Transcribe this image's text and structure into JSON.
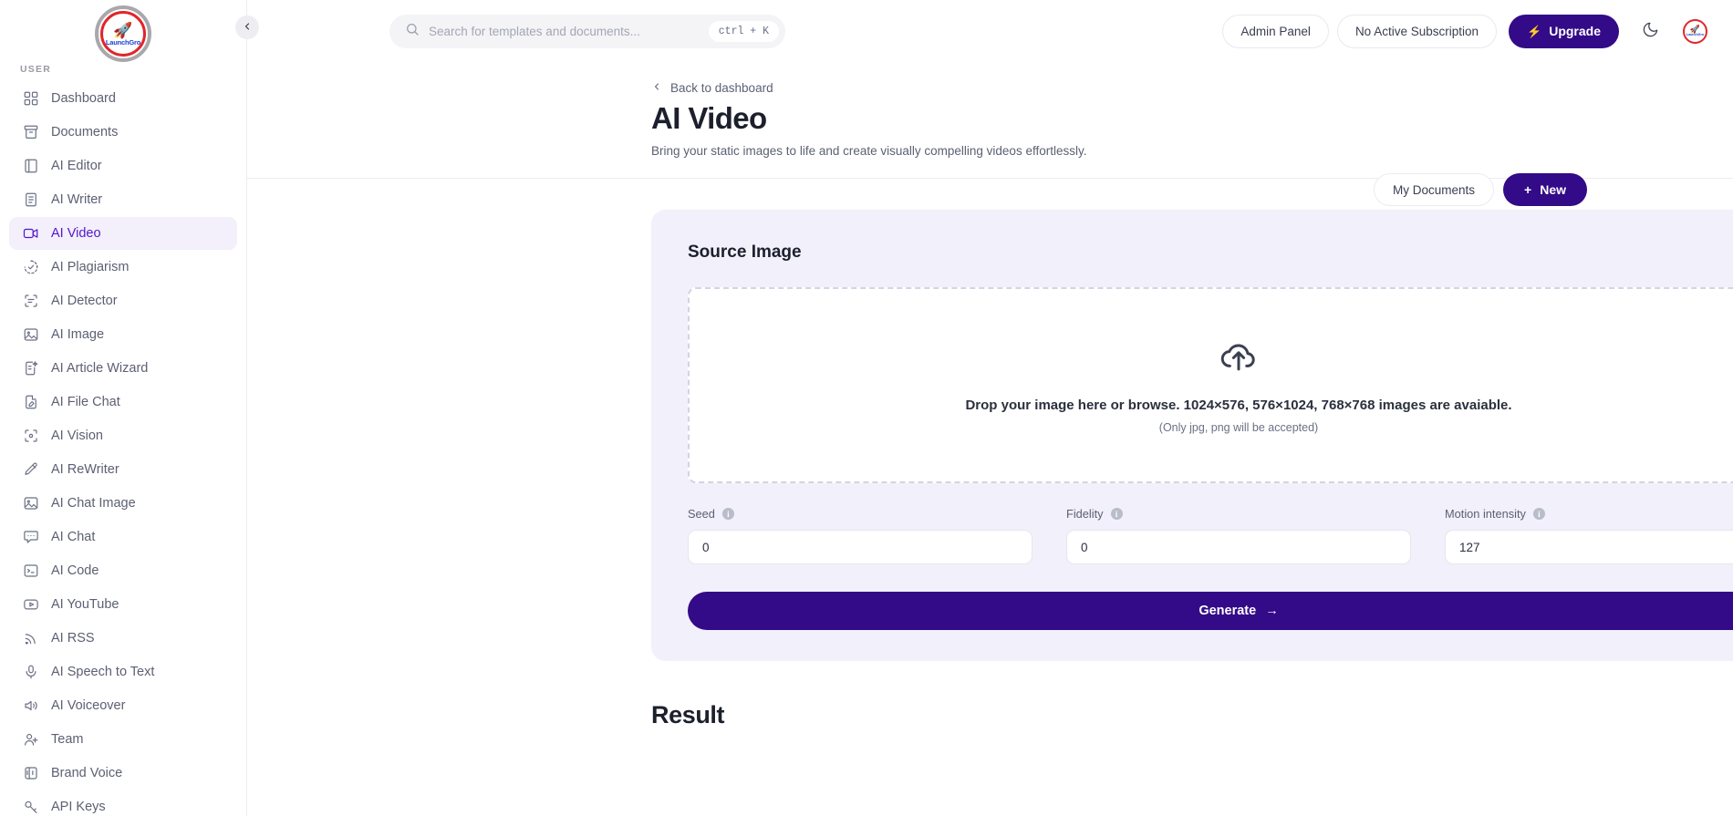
{
  "brand": {
    "logo_rocket": "rocket-icon",
    "logo_text": "LaunchGro"
  },
  "sidebar": {
    "section_label": "USER",
    "items": [
      {
        "label": "Dashboard",
        "icon": "grid-icon",
        "active": false
      },
      {
        "label": "Documents",
        "icon": "archive-icon",
        "active": false
      },
      {
        "label": "AI Editor",
        "icon": "book-icon",
        "active": false
      },
      {
        "label": "AI Writer",
        "icon": "file-text-icon",
        "active": false
      },
      {
        "label": "AI Video",
        "icon": "video-icon",
        "active": true
      },
      {
        "label": "AI Plagiarism",
        "icon": "check-circle-dashed-icon",
        "active": false
      },
      {
        "label": "AI Detector",
        "icon": "scan-text-icon",
        "active": false
      },
      {
        "label": "AI Image",
        "icon": "image-icon",
        "active": false
      },
      {
        "label": "AI Article Wizard",
        "icon": "file-sparkle-icon",
        "active": false
      },
      {
        "label": "AI File Chat",
        "icon": "file-pen-icon",
        "active": false
      },
      {
        "label": "AI Vision",
        "icon": "scan-eye-icon",
        "active": false
      },
      {
        "label": "AI ReWriter",
        "icon": "pencil-icon",
        "active": false
      },
      {
        "label": "AI Chat Image",
        "icon": "image-icon",
        "active": false
      },
      {
        "label": "AI Chat",
        "icon": "message-square-icon",
        "active": false
      },
      {
        "label": "AI Code",
        "icon": "terminal-icon",
        "active": false
      },
      {
        "label": "AI YouTube",
        "icon": "youtube-icon",
        "active": false
      },
      {
        "label": "AI RSS",
        "icon": "rss-icon",
        "active": false
      },
      {
        "label": "AI Speech to Text",
        "icon": "microphone-icon",
        "active": false
      },
      {
        "label": "AI Voiceover",
        "icon": "volume-icon",
        "active": false
      },
      {
        "label": "Team",
        "icon": "user-plus-icon",
        "active": false
      },
      {
        "label": "Brand Voice",
        "icon": "panels-icon",
        "active": false
      },
      {
        "label": "API Keys",
        "icon": "key-icon",
        "active": false
      }
    ],
    "collapse_icon": "chevron-left-icon"
  },
  "topbar": {
    "search_placeholder": "Search for templates and documents...",
    "search_value": "",
    "search_icon": "search-icon",
    "shortcut": "ctrl + K",
    "admin_panel": "Admin Panel",
    "subscription": "No Active Subscription",
    "upgrade": "Upgrade",
    "upgrade_icon": "bolt-icon",
    "theme_icon": "moon-icon",
    "avatar_icon": "user-avatar"
  },
  "page": {
    "back_label": "Back to dashboard",
    "back_icon": "chevron-left-icon",
    "title": "AI Video",
    "subtitle": "Bring your static images to life and create visually compelling videos effortlessly.",
    "my_documents": "My Documents",
    "new_button": "New",
    "new_icon": "plus-icon"
  },
  "source_card": {
    "title": "Source Image",
    "dropzone": {
      "icon": "upload-cloud-icon",
      "main_text": "Drop your image here or browse. 1024×576, 576×1024, 768×768 images are avaiable.",
      "sub_text": "(Only jpg, png will be accepted)"
    },
    "fields": [
      {
        "label": "Seed",
        "value": "0",
        "info_icon": "info-icon",
        "info_glyph": "i"
      },
      {
        "label": "Fidelity",
        "value": "0",
        "info_icon": "info-icon",
        "info_glyph": "i"
      },
      {
        "label": "Motion intensity",
        "value": "127",
        "info_icon": "info-icon",
        "info_glyph": "i"
      }
    ],
    "generate_label": "Generate",
    "generate_icon": "arrow-right-icon"
  },
  "result": {
    "title": "Result"
  },
  "colors": {
    "accent": "#330a87",
    "accent_soft": "#f3effb",
    "card_bg": "#f1f0fb",
    "text": "#1c202c",
    "muted": "#5c6072",
    "brand_red": "#e0262a",
    "brand_blue": "#1a3fd4"
  }
}
